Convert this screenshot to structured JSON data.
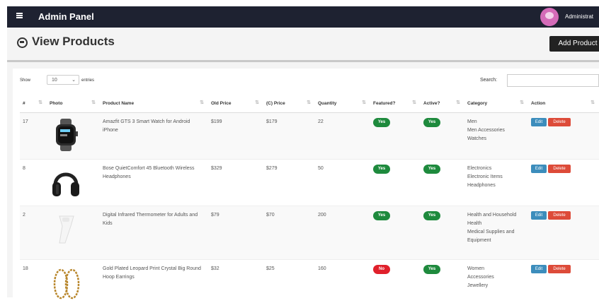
{
  "header": {
    "brand": "Admin Panel",
    "admin_name": "Administrat"
  },
  "page": {
    "title": "View Products",
    "add_button": "Add Product"
  },
  "controls": {
    "show_label": "Show",
    "page_length": "10",
    "entries_label": "entries",
    "search_label": "Search:",
    "search_value": ""
  },
  "table": {
    "headers": [
      "#",
      "Photo",
      "Product Name",
      "Old Price",
      "(C) Price",
      "Quantity",
      "Featured?",
      "Active?",
      "Category",
      "Action"
    ],
    "rows": [
      {
        "id": "17",
        "photo": "smartwatch-image",
        "name": "Amazfit GTS 3 Smart Watch for Android iPhone",
        "old_price": "$199",
        "price": "$179",
        "quantity": "22",
        "featured": "Yes",
        "active": "Yes",
        "category": [
          "Men",
          "Men Accessories",
          "Watches"
        ],
        "edit": "Edit",
        "delete": "Delete"
      },
      {
        "id": "8",
        "photo": "headphones-image",
        "name": "Bose QuietComfort 45 Bluetooth Wireless Headphones",
        "old_price": "$329",
        "price": "$279",
        "quantity": "50",
        "featured": "Yes",
        "active": "Yes",
        "category": [
          "Electronics",
          "Electronic Items",
          "Headphones"
        ],
        "edit": "Edit",
        "delete": "Delete"
      },
      {
        "id": "2",
        "photo": "thermometer-image",
        "name": "Digital Infrared Thermometer for Adults and Kids",
        "old_price": "$79",
        "price": "$70",
        "quantity": "200",
        "featured": "Yes",
        "active": "Yes",
        "category": [
          "Health and Household",
          "Health",
          "Medical Supplies and Equipment"
        ],
        "edit": "Edit",
        "delete": "Delete"
      },
      {
        "id": "18",
        "photo": "earrings-image",
        "name": "Gold Plated Leopard Print Crystal Big Round Hoop Earrings",
        "old_price": "$32",
        "price": "$25",
        "quantity": "160",
        "featured": "No",
        "active": "Yes",
        "category": [
          "Women",
          "Accessories",
          "Jewellery"
        ],
        "edit": "Edit",
        "delete": "Delete"
      }
    ]
  },
  "colors": {
    "topbar": "#1e2231",
    "yes": "#1e8a3d",
    "no": "#e0202b",
    "edit": "#3c8dbc",
    "delete": "#dd4b39"
  }
}
